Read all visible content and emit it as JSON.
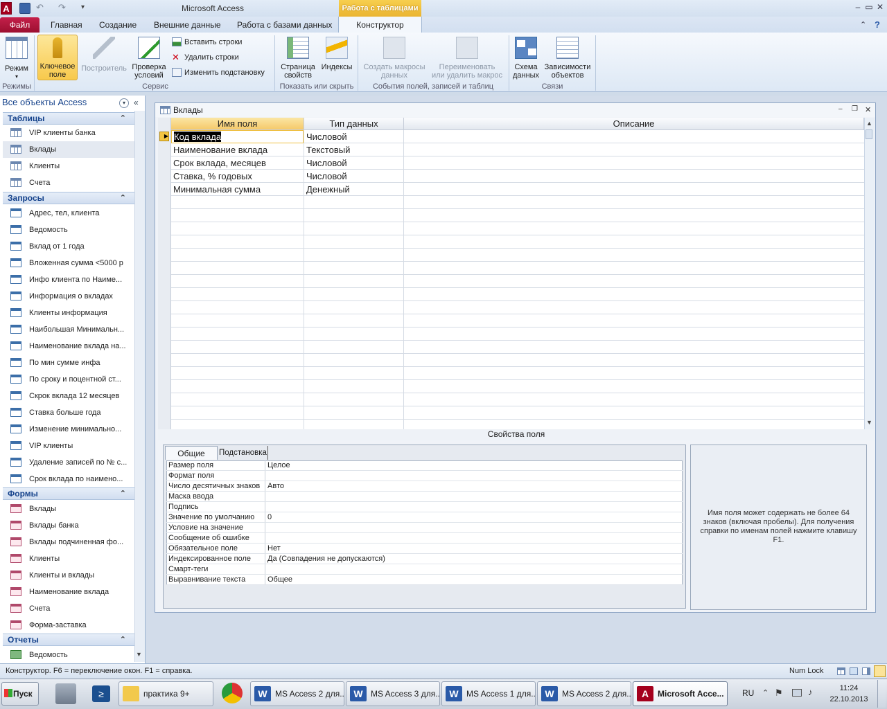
{
  "window": {
    "title": "Microsoft Access",
    "context_tab_group": "Работа с таблицами"
  },
  "tabs": {
    "file": "Файл",
    "home": "Главная",
    "create": "Создание",
    "external": "Внешние данные",
    "database": "Работа с базами данных",
    "design": "Конструктор"
  },
  "ribbon": {
    "view": "Режим",
    "views_group": "Режимы",
    "primary_key_line1": "Ключевое",
    "primary_key_line2": "поле",
    "builder": "Построитель",
    "test_rules_line1": "Проверка",
    "test_rules_line2": "условий",
    "insert_rows": "Вставить строки",
    "delete_rows": "Удалить строки",
    "modify_lookups": "Изменить подстановку",
    "tools_group": "Сервис",
    "property_sheet_line1": "Страница",
    "property_sheet_line2": "свойств",
    "indexes": "Индексы",
    "show_hide_group": "Показать или скрыть",
    "create_macros_line1": "Создать макросы",
    "create_macros_line2": "данных",
    "rename_macro_line1": "Переименовать",
    "rename_macro_line2": "или удалить макрос",
    "events_group": "События полей, записей и таблиц",
    "relationships_line1": "Схема",
    "relationships_line2": "данных",
    "dependencies_line1": "Зависимости",
    "dependencies_line2": "объектов",
    "relations_group": "Связи"
  },
  "nav": {
    "header": "Все объекты Access",
    "tables_title": "Таблицы",
    "tables": [
      "VIP клиенты банка",
      "Вклады",
      "Клиенты",
      "Счета"
    ],
    "queries_title": "Запросы",
    "queries": [
      "Адрес, тел, клиента",
      "Ведомость",
      "Вклад от 1 года",
      "Вложенная сумма <5000 р",
      "Инфо клиента по Наиме...",
      "Информация о вкладах",
      "Клиенты информация",
      "Наибольшая Минимальн...",
      "Наименование вклада на...",
      "По мин сумме инфа",
      "По сроку и поцентной ст...",
      "Скрок вклада 12 месяцев",
      "Ставка больше года",
      "Изменение минимально...",
      "VIP клиенты",
      "Удаление записей по № с...",
      "Срок вклада по наимено..."
    ],
    "forms_title": "Формы",
    "forms": [
      "Вклады",
      "Вклады банка",
      "Вклады подчиненная фо...",
      "Клиенты",
      "Клиенты и вклады",
      "Наименование вклада",
      "Счета",
      "Форма-заставка"
    ],
    "reports_title": "Отчеты",
    "reports": [
      "Ведомость"
    ]
  },
  "document": {
    "title": "Вклады",
    "columns": [
      "Имя поля",
      "Тип данных",
      "Описание"
    ],
    "rows": [
      {
        "name": "Код вклада",
        "type": "Числовой"
      },
      {
        "name": "Наименование вклада",
        "type": "Текстовый"
      },
      {
        "name": "Срок вклада, месяцев",
        "type": "Числовой"
      },
      {
        "name": "Ставка, % годовых",
        "type": "Числовой"
      },
      {
        "name": "Минимальная сумма",
        "type": "Денежный"
      }
    ],
    "props_label": "Свойства поля",
    "props_tabs": [
      "Общие",
      "Подстановка"
    ],
    "props": [
      {
        "label": "Размер поля",
        "value": "Целое"
      },
      {
        "label": "Формат поля",
        "value": ""
      },
      {
        "label": "Число десятичных знаков",
        "value": "Авто"
      },
      {
        "label": "Маска ввода",
        "value": ""
      },
      {
        "label": "Подпись",
        "value": ""
      },
      {
        "label": "Значение по умолчанию",
        "value": "0"
      },
      {
        "label": "Условие на значение",
        "value": ""
      },
      {
        "label": "Сообщение об ошибке",
        "value": ""
      },
      {
        "label": "Обязательное поле",
        "value": "Нет"
      },
      {
        "label": "Индексированное поле",
        "value": "Да (Совпадения не допускаются)"
      },
      {
        "label": "Смарт-теги",
        "value": ""
      },
      {
        "label": "Выравнивание текста",
        "value": "Общее"
      }
    ],
    "help": "Имя поля может содержать не более 64 знаков (включая пробелы). Для получения справки по именам полей нажмите клавишу F1."
  },
  "status": {
    "text": "Конструктор.  F6 = переключение окон.  F1 = справка.",
    "numlock": "Num Lock"
  },
  "taskbar": {
    "start": "Пуск",
    "items": [
      "практика 9+",
      "MS Access 2 для...",
      "MS Access 3 для...",
      "MS Access 1 для...",
      "MS Access 2 для...",
      "Microsoft Acce..."
    ],
    "lang": "RU",
    "time": "11:24",
    "date": "22.10.2013"
  },
  "colors": {
    "accent": "#c4204a",
    "context": "#f5c96a",
    "selected_header": "#f5c96a"
  }
}
